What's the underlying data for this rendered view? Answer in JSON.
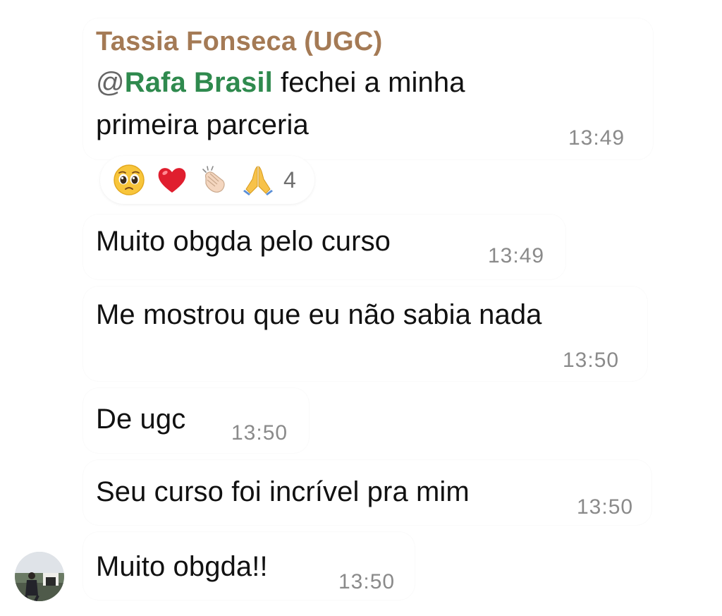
{
  "sender_name": "Tassia Fonseca (UGC)",
  "messages": [
    {
      "mention_prefix": "@",
      "mention": "Rafa Brasil",
      "line1_rest": " fechei a minha",
      "line2": "primeira parceria",
      "time": "13:49"
    },
    {
      "text": "Muito obgda pelo curso",
      "time": "13:49"
    },
    {
      "text": "Me mostrou que eu não sabia nada",
      "time": "13:50"
    },
    {
      "text": "De ugc",
      "time": "13:50"
    },
    {
      "text": "Seu curso foi incrível pra mim",
      "time": "13:50"
    },
    {
      "text": "Muito obgda!!",
      "time": "13:50"
    }
  ],
  "reactions": {
    "items": [
      "pleading-face-icon",
      "red-heart-icon",
      "clapping-hands-icon",
      "folded-hands-icon"
    ],
    "count": "4"
  },
  "colors": {
    "sender": "#a47a55",
    "mention": "#2f8a4e",
    "time": "#8a8a8a",
    "text": "#111111"
  }
}
